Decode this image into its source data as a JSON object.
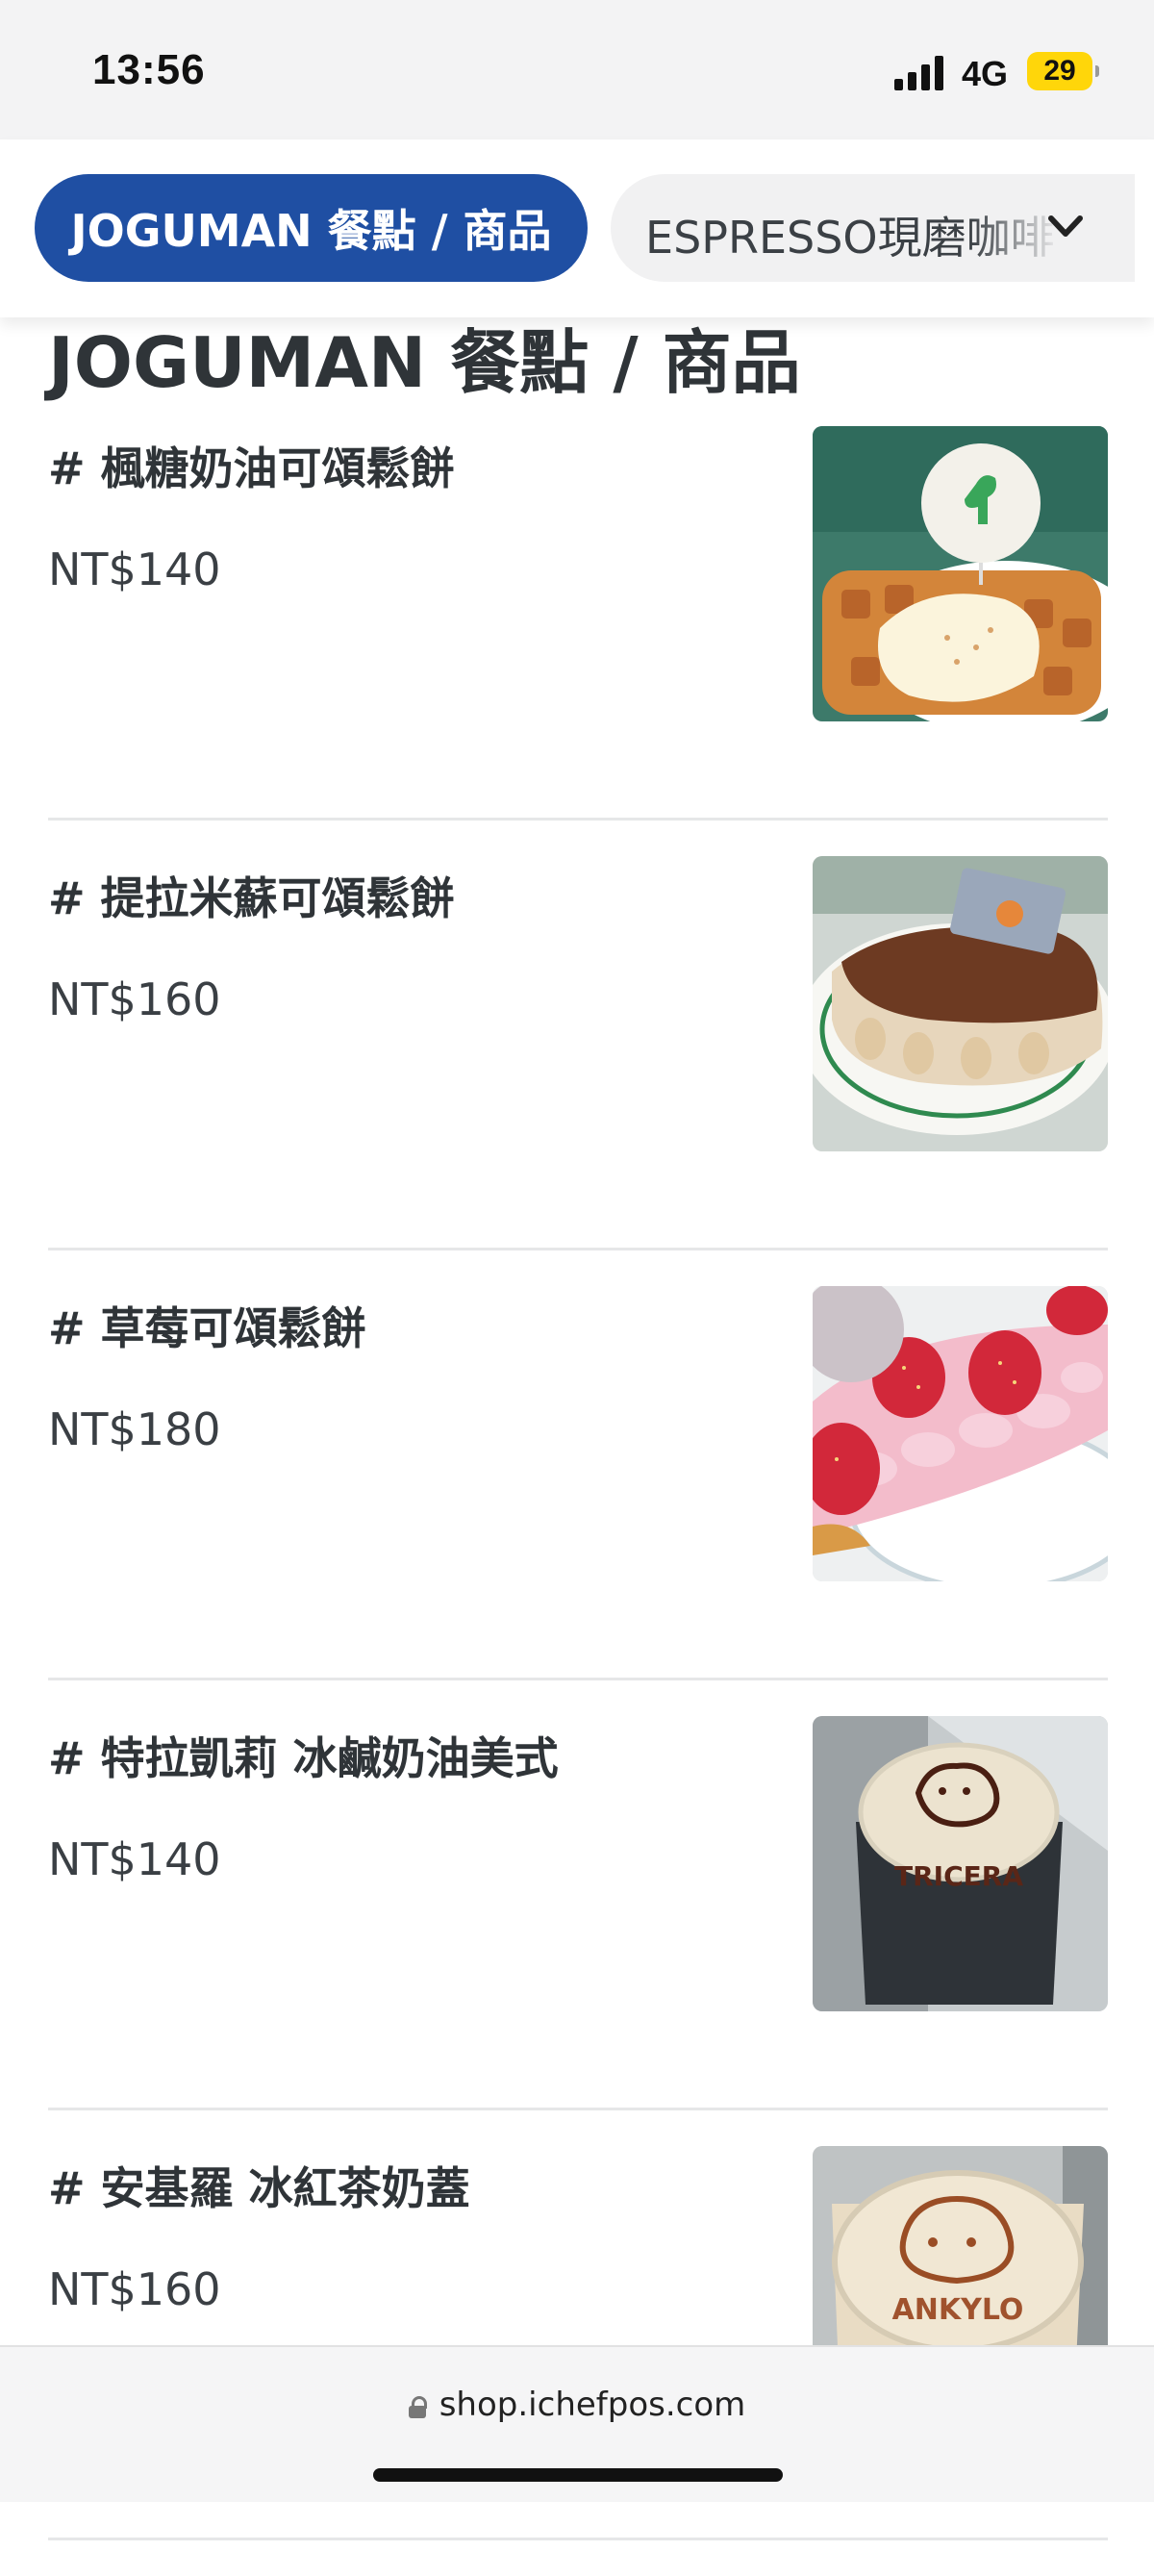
{
  "status_bar": {
    "time": "13:56",
    "network": "4G",
    "battery": "29"
  },
  "category_nav": {
    "active_label": "JOGUMAN 餐點 / 商品",
    "inactive_label": "ESPRESSO現磨咖啡"
  },
  "section": {
    "title": "JOGUMAN 餐點 / 商品",
    "items": [
      {
        "name": "# 楓糖奶油可頌鬆餅",
        "price": "NT$140"
      },
      {
        "name": "# 提拉米蘇可頌鬆餅",
        "price": "NT$160"
      },
      {
        "name": "# 草莓可頌鬆餅",
        "price": "NT$180"
      },
      {
        "name": "# 特拉凱莉 冰鹹奶油美式",
        "price": "NT$140",
        "image_text": "TRICERA"
      },
      {
        "name": "# 安基羅 冰紅茶奶蓋",
        "price": "NT$160",
        "image_text": "ANKYLO"
      }
    ]
  },
  "browser": {
    "url": "shop.ichefpos.com"
  },
  "colors": {
    "accent": "#1f4fa3",
    "text": "#2f3438",
    "divider": "#e6e7e8"
  }
}
